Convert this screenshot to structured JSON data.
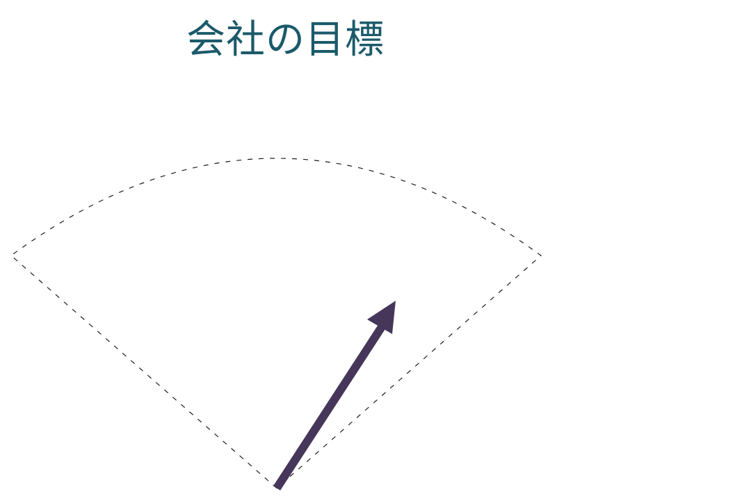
{
  "title": {
    "text": "会社の目標",
    "color": "#1b5a6a"
  },
  "diagram": {
    "sector_outline_color": "#1a1a1a",
    "arrow_color": "#45365a"
  }
}
